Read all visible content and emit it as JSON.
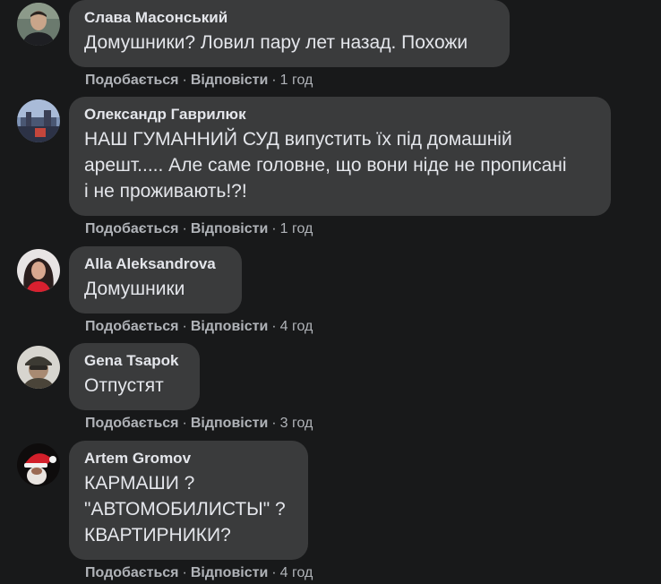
{
  "actions": {
    "like_label": "Подобається",
    "reply_label": "Відповісти",
    "separator": "·"
  },
  "comments": [
    {
      "author": "Слава Масонський",
      "text": "Домушники? Ловил пару лет назад. Похожи",
      "time": "1 год",
      "avatar_icon": "user-avatar-photo"
    },
    {
      "author": "Олександр Гаврилюк",
      "text": "НАШ ГУМАННИЙ СУД випустить їх під домашній\nарешт..... Але саме головне, що вони ніде не прописані\nі не проживають!?!",
      "time": "1 год",
      "avatar_icon": "user-avatar-photo"
    },
    {
      "author": "Alla Aleksandrova",
      "text": "Домушники",
      "time": "4 год",
      "avatar_icon": "user-avatar-photo"
    },
    {
      "author": "Gena Tsapok",
      "text": "Отпустят",
      "time": "3 год",
      "avatar_icon": "user-avatar-photo"
    },
    {
      "author": "Artem Gromov",
      "text": "КАРМАШИ ?\n\"АВТОМОБИЛИСТЫ\" ?\nКВАРТИРНИКИ?",
      "time": "4 год",
      "avatar_icon": "user-avatar-photo"
    }
  ],
  "colors": {
    "background": "#18191a",
    "bubble": "#3a3b3c",
    "primary_text": "#e4e6eb",
    "secondary_text": "#b0b3b8"
  }
}
